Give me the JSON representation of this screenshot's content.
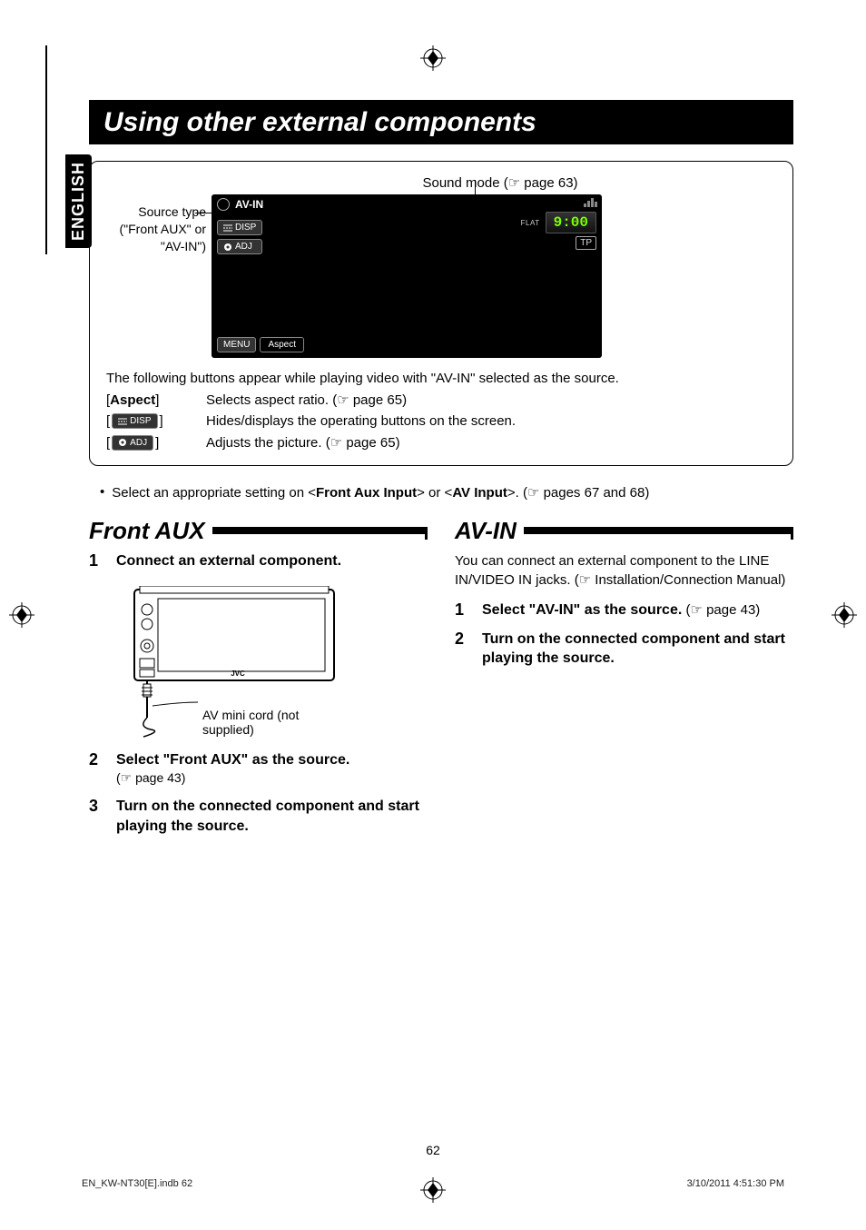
{
  "lang_tab": "ENGLISH",
  "title": "Using other external components",
  "diagram": {
    "sound_mode_label": "Sound mode (☞ page 63)",
    "source_type_label": "Source type (\"Front AUX\" or \"AV-IN\")",
    "screenshot": {
      "source_label": "AV-IN",
      "disp_btn": "DISP",
      "adj_btn": "ADJ",
      "flat_label": "FLAT",
      "time": "9:00",
      "tp": "TP",
      "menu_btn": "MENU",
      "aspect_btn": "Aspect"
    },
    "note": "The following buttons appear while playing video with \"AV-IN\" selected as the source.",
    "rows": [
      {
        "key": "[Aspect]",
        "key_bold": "Aspect",
        "desc": "Selects aspect ratio. (☞ page 65)"
      },
      {
        "key_btn": "DISP",
        "key_btn_icon": "bars",
        "desc": "Hides/displays the operating buttons on the screen."
      },
      {
        "key_btn": "ADJ",
        "key_btn_icon": "knob",
        "desc": "Adjusts the picture. (☞ page 65)"
      }
    ]
  },
  "bullet": {
    "prefix": "• ",
    "text": "Select an appropriate setting on <",
    "b1": "Front Aux Input",
    "mid": "> or <",
    "b2": "AV Input",
    "suffix": ">. (☞ pages 67 and 68)"
  },
  "left": {
    "heading": "Front AUX",
    "steps": [
      {
        "num": "1",
        "title": "Connect an external component."
      },
      {
        "num_img_caption": "AV mini cord (not supplied)"
      },
      {
        "num": "2",
        "title": "Select \"Front AUX\" as the source.",
        "sub": "(☞ page 43)"
      },
      {
        "num": "3",
        "title": "Turn on the connected component and start playing the source."
      }
    ]
  },
  "right": {
    "heading": "AV-IN",
    "intro": "You can connect an external component to the LINE IN/VIDEO IN jacks. (☞ Installation/Connection Manual)",
    "steps": [
      {
        "num": "1",
        "title": "Select \"AV-IN\" as the source.",
        "tail": " (☞ page 43)"
      },
      {
        "num": "2",
        "title": "Turn on the connected component and start playing the source."
      }
    ]
  },
  "page_number": "62",
  "footer_left": "EN_KW-NT30[E].indb   62",
  "footer_right": "3/10/2011   4:51:30 PM"
}
